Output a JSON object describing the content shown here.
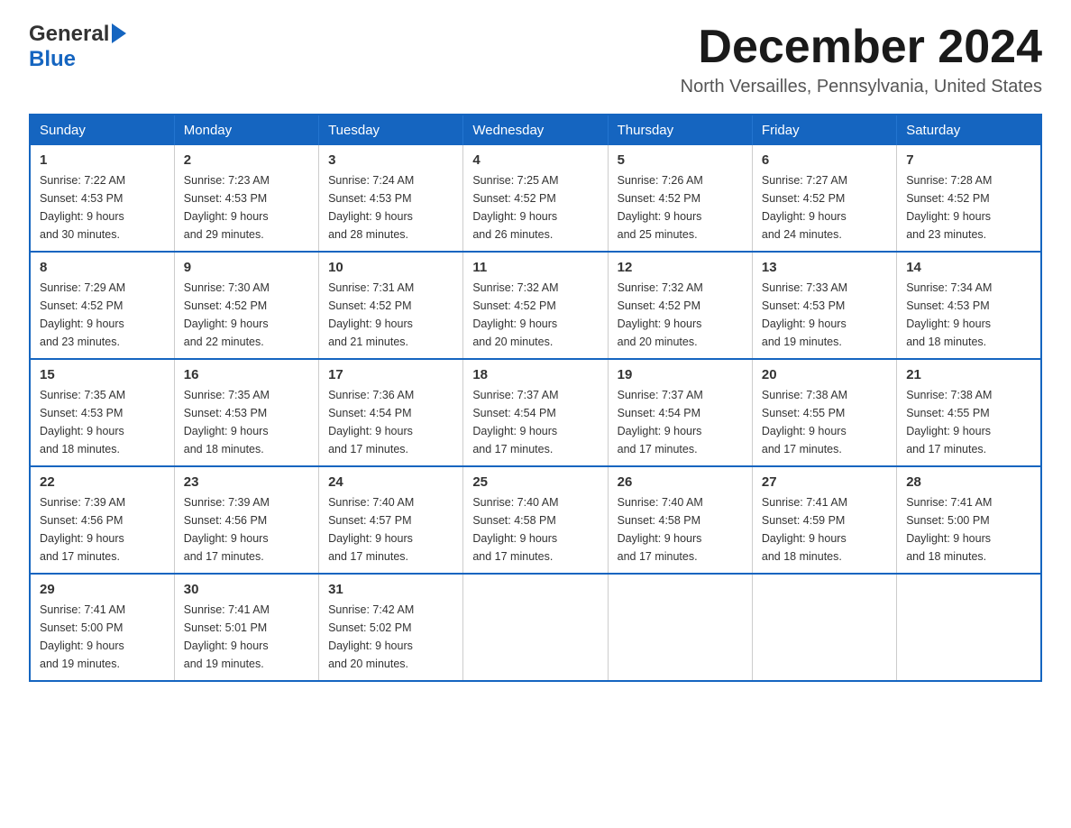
{
  "header": {
    "logo_general": "General",
    "logo_blue": "Blue",
    "month_title": "December 2024",
    "location": "North Versailles, Pennsylvania, United States"
  },
  "days_of_week": [
    "Sunday",
    "Monday",
    "Tuesday",
    "Wednesday",
    "Thursday",
    "Friday",
    "Saturday"
  ],
  "weeks": [
    [
      {
        "day": "1",
        "sunrise": "7:22 AM",
        "sunset": "4:53 PM",
        "daylight": "9 hours and 30 minutes."
      },
      {
        "day": "2",
        "sunrise": "7:23 AM",
        "sunset": "4:53 PM",
        "daylight": "9 hours and 29 minutes."
      },
      {
        "day": "3",
        "sunrise": "7:24 AM",
        "sunset": "4:53 PM",
        "daylight": "9 hours and 28 minutes."
      },
      {
        "day": "4",
        "sunrise": "7:25 AM",
        "sunset": "4:52 PM",
        "daylight": "9 hours and 26 minutes."
      },
      {
        "day": "5",
        "sunrise": "7:26 AM",
        "sunset": "4:52 PM",
        "daylight": "9 hours and 25 minutes."
      },
      {
        "day": "6",
        "sunrise": "7:27 AM",
        "sunset": "4:52 PM",
        "daylight": "9 hours and 24 minutes."
      },
      {
        "day": "7",
        "sunrise": "7:28 AM",
        "sunset": "4:52 PM",
        "daylight": "9 hours and 23 minutes."
      }
    ],
    [
      {
        "day": "8",
        "sunrise": "7:29 AM",
        "sunset": "4:52 PM",
        "daylight": "9 hours and 23 minutes."
      },
      {
        "day": "9",
        "sunrise": "7:30 AM",
        "sunset": "4:52 PM",
        "daylight": "9 hours and 22 minutes."
      },
      {
        "day": "10",
        "sunrise": "7:31 AM",
        "sunset": "4:52 PM",
        "daylight": "9 hours and 21 minutes."
      },
      {
        "day": "11",
        "sunrise": "7:32 AM",
        "sunset": "4:52 PM",
        "daylight": "9 hours and 20 minutes."
      },
      {
        "day": "12",
        "sunrise": "7:32 AM",
        "sunset": "4:52 PM",
        "daylight": "9 hours and 20 minutes."
      },
      {
        "day": "13",
        "sunrise": "7:33 AM",
        "sunset": "4:53 PM",
        "daylight": "9 hours and 19 minutes."
      },
      {
        "day": "14",
        "sunrise": "7:34 AM",
        "sunset": "4:53 PM",
        "daylight": "9 hours and 18 minutes."
      }
    ],
    [
      {
        "day": "15",
        "sunrise": "7:35 AM",
        "sunset": "4:53 PM",
        "daylight": "9 hours and 18 minutes."
      },
      {
        "day": "16",
        "sunrise": "7:35 AM",
        "sunset": "4:53 PM",
        "daylight": "9 hours and 18 minutes."
      },
      {
        "day": "17",
        "sunrise": "7:36 AM",
        "sunset": "4:54 PM",
        "daylight": "9 hours and 17 minutes."
      },
      {
        "day": "18",
        "sunrise": "7:37 AM",
        "sunset": "4:54 PM",
        "daylight": "9 hours and 17 minutes."
      },
      {
        "day": "19",
        "sunrise": "7:37 AM",
        "sunset": "4:54 PM",
        "daylight": "9 hours and 17 minutes."
      },
      {
        "day": "20",
        "sunrise": "7:38 AM",
        "sunset": "4:55 PM",
        "daylight": "9 hours and 17 minutes."
      },
      {
        "day": "21",
        "sunrise": "7:38 AM",
        "sunset": "4:55 PM",
        "daylight": "9 hours and 17 minutes."
      }
    ],
    [
      {
        "day": "22",
        "sunrise": "7:39 AM",
        "sunset": "4:56 PM",
        "daylight": "9 hours and 17 minutes."
      },
      {
        "day": "23",
        "sunrise": "7:39 AM",
        "sunset": "4:56 PM",
        "daylight": "9 hours and 17 minutes."
      },
      {
        "day": "24",
        "sunrise": "7:40 AM",
        "sunset": "4:57 PM",
        "daylight": "9 hours and 17 minutes."
      },
      {
        "day": "25",
        "sunrise": "7:40 AM",
        "sunset": "4:58 PM",
        "daylight": "9 hours and 17 minutes."
      },
      {
        "day": "26",
        "sunrise": "7:40 AM",
        "sunset": "4:58 PM",
        "daylight": "9 hours and 17 minutes."
      },
      {
        "day": "27",
        "sunrise": "7:41 AM",
        "sunset": "4:59 PM",
        "daylight": "9 hours and 18 minutes."
      },
      {
        "day": "28",
        "sunrise": "7:41 AM",
        "sunset": "5:00 PM",
        "daylight": "9 hours and 18 minutes."
      }
    ],
    [
      {
        "day": "29",
        "sunrise": "7:41 AM",
        "sunset": "5:00 PM",
        "daylight": "9 hours and 19 minutes."
      },
      {
        "day": "30",
        "sunrise": "7:41 AM",
        "sunset": "5:01 PM",
        "daylight": "9 hours and 19 minutes."
      },
      {
        "day": "31",
        "sunrise": "7:42 AM",
        "sunset": "5:02 PM",
        "daylight": "9 hours and 20 minutes."
      },
      null,
      null,
      null,
      null
    ]
  ],
  "labels": {
    "sunrise": "Sunrise:",
    "sunset": "Sunset:",
    "daylight": "Daylight:"
  }
}
